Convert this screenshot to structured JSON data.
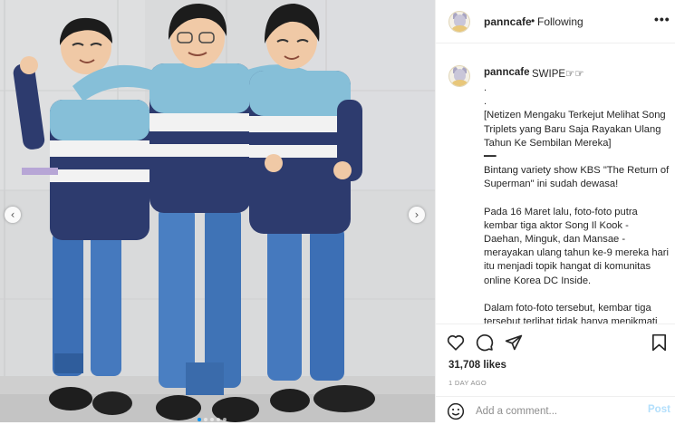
{
  "post": {
    "username": "panncafe",
    "separator": "•",
    "follow_status": "Following",
    "more_icon": "more-horizontal-icon"
  },
  "caption": {
    "username": "panncafe",
    "first_line": "SWIPE☞☞",
    "paragraphs": [
      ".\n.\n[Netizen Mengaku Terkejut Melihat Song Triplets yang Baru Saja Rayakan Ulang Tahun Ke Sembilan Mereka]\n━━",
      "Bintang variety show KBS \"The Return of Superman\" ini sudah dewasa!",
      "Pada 16 Maret lalu, foto-foto putra kembar tiga aktor Song Il Kook - Daehan, Minguk, dan Mansae - merayakan ulang tahun ke-9 mereka hari itu menjadi topik hangat di komunitas online Korea DC Inside.",
      "Dalam foto-foto tersebut, kembar tiga tersebut terlihat tidak hanya menikmati kue ulang tahun mereka"
    ]
  },
  "media": {
    "prev_icon": "chevron-left-icon",
    "next_icon": "chevron-right-icon",
    "slide_count": 5,
    "active_slide": 1
  },
  "actions": {
    "likes": "31,708 likes",
    "time": "1 DAY AGO"
  },
  "comment": {
    "placeholder": "Add a comment...",
    "post_label": "Post"
  },
  "colors": {
    "accent": "#0095f6",
    "post_disabled": "#b2dffc",
    "muted": "#8e8e8e"
  }
}
